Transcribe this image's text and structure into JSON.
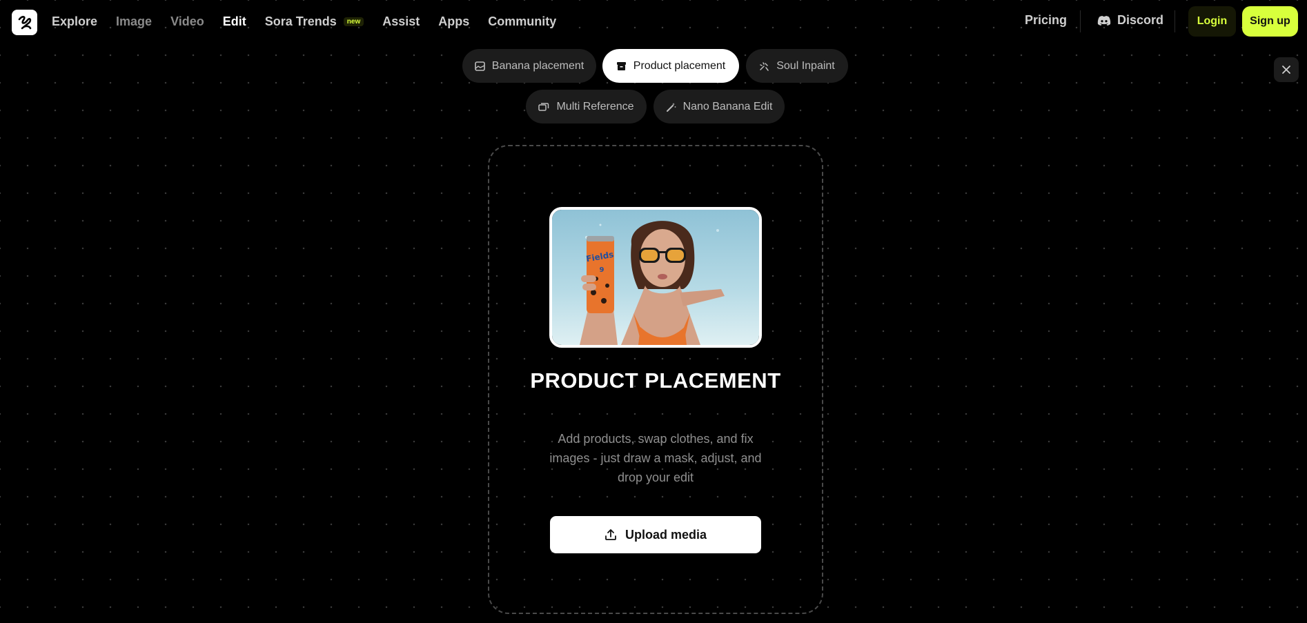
{
  "nav": {
    "links": [
      {
        "label": "Explore"
      },
      {
        "label": "Image"
      },
      {
        "label": "Video"
      },
      {
        "label": "Edit"
      },
      {
        "label": "Sora Trends",
        "badge": "new"
      },
      {
        "label": "Assist"
      },
      {
        "label": "Apps"
      },
      {
        "label": "Community"
      }
    ],
    "active": "Edit",
    "pricing": "Pricing",
    "discord": "Discord",
    "login": "Login",
    "signup": "Sign up",
    "accent_color": "#d8ff3c"
  },
  "modes": [
    {
      "label": "Banana placement",
      "icon": "image-icon"
    },
    {
      "label": "Product placement",
      "icon": "box-icon",
      "active": true
    },
    {
      "label": "Soul Inpaint",
      "icon": "inpaint-icon"
    },
    {
      "label": "Multi Reference",
      "icon": "layers-icon"
    },
    {
      "label": "Nano Banana Edit",
      "icon": "magic-wand-icon"
    }
  ],
  "main": {
    "title": "PRODUCT PLACEMENT",
    "description": "Add products, swap clothes, and fix images - just draw a mask, adjust, and drop your edit",
    "upload_label": "Upload media",
    "preview_can_text": "Fields",
    "preview_can_number": "9"
  }
}
